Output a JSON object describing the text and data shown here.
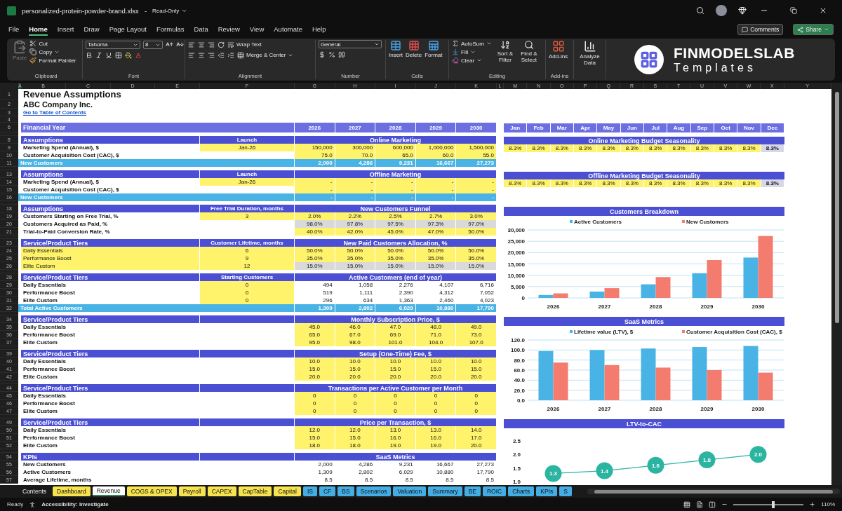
{
  "window": {
    "title": "personalized-protein-powder-brand.xlsx",
    "separator": "-",
    "mode": "Read-Only"
  },
  "menu": [
    {
      "label": "File",
      "selected": false
    },
    {
      "label": "Home",
      "selected": true
    },
    {
      "label": "Insert",
      "selected": false
    },
    {
      "label": "Draw",
      "selected": false
    },
    {
      "label": "Page Layout",
      "selected": false
    },
    {
      "label": "Formulas",
      "selected": false
    },
    {
      "label": "Data",
      "selected": false
    },
    {
      "label": "Review",
      "selected": false
    },
    {
      "label": "View",
      "selected": false
    },
    {
      "label": "Automate",
      "selected": false
    },
    {
      "label": "Help",
      "selected": false
    }
  ],
  "comments_button": "Comments",
  "share_button": "Share",
  "ribbon": {
    "clipboard": {
      "paste": "Paste",
      "paste_disabled": true,
      "cut": "Cut",
      "copy": "Copy",
      "format_painter": "Format Painter",
      "label": "Clipboard"
    },
    "font": {
      "name": "Tahoma",
      "size": "8",
      "label": "Font"
    },
    "alignment": {
      "wrap": "Wrap Text",
      "merge": "Merge & Center",
      "label": "Alignment"
    },
    "number": {
      "format": "General",
      "label": "Number"
    },
    "cells": {
      "insert": "Insert",
      "delete": "Delete",
      "format": "Format",
      "label": "Cells"
    },
    "editing": {
      "autosum": "AutoSum",
      "fill": "Fill",
      "clear": "Clear",
      "sort": "Sort & Filter",
      "find": "Find & Select",
      "label": "Editing"
    },
    "addins": {
      "button": "Add-ins",
      "label": "Add-ins"
    },
    "analyze": "Analyze Data",
    "logo": {
      "name": "FINMODELSLAB",
      "tagline": "Templates"
    }
  },
  "columns": [
    {
      "label": "A",
      "selected": true
    },
    {
      "label": "B",
      "selected": false
    },
    {
      "label": "C",
      "selected": false
    },
    {
      "label": "D",
      "selected": false
    },
    {
      "label": "E",
      "selected": false
    },
    {
      "label": "F",
      "selected": false
    },
    {
      "label": "G",
      "selected": false
    },
    {
      "label": "H",
      "selected": false
    },
    {
      "label": "I",
      "selected": false
    },
    {
      "label": "J",
      "selected": false
    },
    {
      "label": "K",
      "selected": false
    },
    {
      "label": "L",
      "selected": false
    },
    {
      "label": "M",
      "selected": false
    },
    {
      "label": "N",
      "selected": false
    },
    {
      "label": "O",
      "selected": false
    },
    {
      "label": "P",
      "selected": false
    },
    {
      "label": "Q",
      "selected": false
    },
    {
      "label": "R",
      "selected": false
    },
    {
      "label": "S",
      "selected": false
    },
    {
      "label": "T",
      "selected": false
    },
    {
      "label": "U",
      "selected": false
    },
    {
      "label": "V",
      "selected": false
    },
    {
      "label": "W",
      "selected": false
    },
    {
      "label": "X",
      "selected": false
    },
    {
      "label": "Y",
      "selected": false
    }
  ],
  "rows": [
    {
      "kind": "title",
      "row": "1",
      "text": "Revenue Assumptions"
    },
    {
      "kind": "subtitle",
      "row": "2",
      "text": "ABC Company Inc."
    },
    {
      "kind": "link",
      "row": "3",
      "text": "Go to Table of Contents"
    },
    {
      "kind": "blank",
      "row": "4"
    },
    {
      "kind": "year_header",
      "row": "6",
      "label": "Financial Year",
      "years": [
        "2026",
        "2027",
        "2028",
        "2029",
        "2030"
      ]
    },
    {
      "kind": "gap"
    },
    {
      "kind": "section",
      "row": "8",
      "label": "Assumptions",
      "mid": "Launch",
      "span": "Online Marketing"
    },
    {
      "kind": "input",
      "row": "9",
      "label": "Marketing Spend (Annual), $",
      "label_input": false,
      "mid": "Jan-26",
      "mid_input": true,
      "centered": false,
      "values": [
        "150,000",
        "300,000",
        "600,000",
        "1,000,000",
        "1,500,000"
      ]
    },
    {
      "kind": "input",
      "row": "10",
      "label": "Customer Acquisition Cost (CAC), $",
      "label_input": false,
      "mid_input": false,
      "centered": false,
      "values": [
        "75.0",
        "70.0",
        "65.0",
        "60.0",
        "55.0"
      ]
    },
    {
      "kind": "total",
      "row": "11",
      "label": "New Customers",
      "centered": false,
      "values": [
        "2,000",
        "4,286",
        "9,231",
        "16,667",
        "27,273"
      ]
    },
    {
      "kind": "gap"
    },
    {
      "kind": "section",
      "row": "13",
      "label": "Assumptions",
      "mid": "Launch",
      "span": "Offline Marketing"
    },
    {
      "kind": "input",
      "row": "14",
      "label": "Marketing Spend (Annual), $",
      "label_input": false,
      "mid": "Jan-26",
      "mid_input": true,
      "centered": false,
      "values": [
        "-",
        "-",
        "-",
        "-",
        "-"
      ]
    },
    {
      "kind": "input",
      "row": "15",
      "label": "Customer Acquisition Cost (CAC), $",
      "label_input": false,
      "mid_input": false,
      "centered": false,
      "values": [
        "-",
        "-",
        "-",
        "-",
        "-"
      ]
    },
    {
      "kind": "total",
      "row": "16",
      "label": "New Customers",
      "centered": false,
      "values": [
        "-",
        "-",
        "-",
        "-",
        "-"
      ]
    },
    {
      "kind": "gap"
    },
    {
      "kind": "section",
      "row": "18",
      "label": "Assumptions",
      "mid": "Free Trial Duration, months",
      "span": "New Customers Funnel"
    },
    {
      "kind": "input",
      "row": "19",
      "label": "Customers Starting on Free Trial, %",
      "label_input": false,
      "mid": "3",
      "mid_input": true,
      "centered": true,
      "values": [
        "2.0%",
        "2.2%",
        "2.5%",
        "2.7%",
        "3.0%"
      ]
    },
    {
      "kind": "gray",
      "row": "20",
      "label": "Customers Acquired as Paid, %",
      "label_input": false,
      "mid_input": false,
      "centered": true,
      "values": [
        "98.0%",
        "97.8%",
        "97.5%",
        "97.3%",
        "97.0%"
      ]
    },
    {
      "kind": "input",
      "row": "21",
      "label": "Trial-to-Paid Conversion Rate, %",
      "label_input": false,
      "mid_input": false,
      "centered": true,
      "values": [
        "40.0%",
        "42.0%",
        "45.0%",
        "47.0%",
        "50.0%"
      ]
    },
    {
      "kind": "gap"
    },
    {
      "kind": "section",
      "row": "23",
      "label": "Service/Product Tiers",
      "mid": "Customer Lifetime, months",
      "span": "New Paid Customers Allocation, %"
    },
    {
      "kind": "input",
      "row": "24",
      "label": "Daily Essentials",
      "label_input": true,
      "mid": "6",
      "mid_input": true,
      "centered": true,
      "values": [
        "50.0%",
        "50.0%",
        "50.0%",
        "50.0%",
        "50.0%"
      ]
    },
    {
      "kind": "input",
      "row": "25",
      "label": "Performance Boost",
      "label_input": true,
      "mid": "9",
      "mid_input": true,
      "centered": true,
      "values": [
        "35.0%",
        "35.0%",
        "35.0%",
        "35.0%",
        "35.0%"
      ]
    },
    {
      "kind": "gray",
      "row": "26",
      "label": "Elite Custom",
      "label_input": true,
      "mid": "12",
      "mid_input": true,
      "centered": true,
      "values": [
        "15.0%",
        "15.0%",
        "15.0%",
        "15.0%",
        "15.0%"
      ]
    },
    {
      "kind": "gap"
    },
    {
      "kind": "section",
      "row": "28",
      "label": "Service/Product Tiers",
      "mid": "Starting Customers",
      "span": "Active Customers (end of year)"
    },
    {
      "kind": "plain",
      "row": "29",
      "label": "Daily Essentials",
      "label_input": false,
      "mid": "0",
      "mid_input": true,
      "centered": false,
      "values": [
        "494",
        "1,058",
        "2,276",
        "4,107",
        "6,716"
      ]
    },
    {
      "kind": "plain",
      "row": "30",
      "label": "Performance Boost",
      "label_input": false,
      "mid": "0",
      "mid_input": true,
      "centered": false,
      "values": [
        "519",
        "1,111",
        "2,390",
        "4,312",
        "7,052"
      ]
    },
    {
      "kind": "plain",
      "row": "31",
      "label": "Elite Custom",
      "label_input": false,
      "mid": "0",
      "mid_input": true,
      "centered": false,
      "values": [
        "296",
        "634",
        "1,363",
        "2,460",
        "4,023"
      ]
    },
    {
      "kind": "total",
      "row": "32",
      "label": "Total Active Customers",
      "centered": false,
      "values": [
        "1,309",
        "2,802",
        "6,029",
        "10,880",
        "17,790"
      ]
    },
    {
      "kind": "gap"
    },
    {
      "kind": "section",
      "row": "34",
      "label": "Service/Product Tiers",
      "span": "Monthly Subscription Price, $"
    },
    {
      "kind": "input",
      "row": "35",
      "label": "Daily Essentials",
      "label_input": false,
      "mid_input": false,
      "centered": true,
      "values": [
        "45.0",
        "46.0",
        "47.0",
        "48.0",
        "49.0"
      ]
    },
    {
      "kind": "input",
      "row": "36",
      "label": "Performance Boost",
      "label_input": false,
      "mid_input": false,
      "centered": true,
      "values": [
        "65.0",
        "67.0",
        "69.0",
        "71.0",
        "73.0"
      ]
    },
    {
      "kind": "input",
      "row": "37",
      "label": "Elite Custom",
      "label_input": false,
      "mid_input": false,
      "centered": true,
      "values": [
        "95.0",
        "98.0",
        "101.0",
        "104.0",
        "107.0"
      ]
    },
    {
      "kind": "gap"
    },
    {
      "kind": "section",
      "row": "39",
      "label": "Service/Product Tiers",
      "span": "Setup (One-Time) Fee, $"
    },
    {
      "kind": "input",
      "row": "40",
      "label": "Daily Essentials",
      "label_input": false,
      "mid_input": false,
      "centered": true,
      "values": [
        "10.0",
        "10.0",
        "10.0",
        "10.0",
        "10.0"
      ]
    },
    {
      "kind": "input",
      "row": "41",
      "label": "Performance Boost",
      "label_input": false,
      "mid_input": false,
      "centered": true,
      "values": [
        "15.0",
        "15.0",
        "15.0",
        "15.0",
        "15.0"
      ]
    },
    {
      "kind": "input",
      "row": "42",
      "label": "Elite Custom",
      "label_input": false,
      "mid_input": false,
      "centered": true,
      "values": [
        "20.0",
        "20.0",
        "20.0",
        "20.0",
        "20.0"
      ]
    },
    {
      "kind": "gap"
    },
    {
      "kind": "section",
      "row": "44",
      "label": "Service/Product Tiers",
      "span": "Transactions per Active Customer per Month"
    },
    {
      "kind": "input",
      "row": "45",
      "label": "Daily Essentials",
      "label_input": false,
      "mid_input": false,
      "centered": true,
      "values": [
        "0",
        "0",
        "0",
        "0",
        "0"
      ]
    },
    {
      "kind": "input",
      "row": "46",
      "label": "Performance Boost",
      "label_input": false,
      "mid_input": false,
      "centered": true,
      "values": [
        "0",
        "0",
        "0",
        "0",
        "0"
      ]
    },
    {
      "kind": "input",
      "row": "47",
      "label": "Elite Custom",
      "label_input": false,
      "mid_input": false,
      "centered": true,
      "values": [
        "0",
        "0",
        "0",
        "0",
        "0"
      ]
    },
    {
      "kind": "gap"
    },
    {
      "kind": "section",
      "row": "49",
      "label": "Service/Product Tiers",
      "span": "Price per Transaction, $"
    },
    {
      "kind": "input",
      "row": "50",
      "label": "Daily Essentials",
      "label_input": false,
      "mid_input": false,
      "centered": true,
      "values": [
        "12.0",
        "12.0",
        "13.0",
        "13.0",
        "14.0"
      ]
    },
    {
      "kind": "input",
      "row": "51",
      "label": "Performance Boost",
      "label_input": false,
      "mid_input": false,
      "centered": true,
      "values": [
        "15.0",
        "15.0",
        "16.0",
        "16.0",
        "17.0"
      ]
    },
    {
      "kind": "input",
      "row": "52",
      "label": "Elite Custom",
      "label_input": false,
      "mid_input": false,
      "centered": true,
      "values": [
        "18.0",
        "18.0",
        "19.0",
        "19.0",
        "20.0"
      ]
    },
    {
      "kind": "gap"
    },
    {
      "kind": "section",
      "row": "54",
      "label": "KPIs",
      "span": "SaaS Metrics"
    },
    {
      "kind": "plain",
      "row": "55",
      "label": "New Customers",
      "label_input": false,
      "mid_input": false,
      "centered": false,
      "values": [
        "2,000",
        "4,286",
        "9,231",
        "16,667",
        "27,273"
      ]
    },
    {
      "kind": "plain",
      "row": "56",
      "label": "Active Customers",
      "label_input": false,
      "mid_input": false,
      "centered": false,
      "values": [
        "1,309",
        "2,802",
        "6,029",
        "10,880",
        "17,790"
      ]
    },
    {
      "kind": "plain",
      "row": "57",
      "label": "Average Lifetime, months",
      "label_input": false,
      "mid_input": false,
      "centered": false,
      "values": [
        "8.5",
        "8.5",
        "8.5",
        "8.5",
        "8.5"
      ]
    }
  ],
  "months": [
    "Jan",
    "Feb",
    "Mar",
    "Apr",
    "May",
    "Jun",
    "Jul",
    "Aug",
    "Sep",
    "Oct",
    "Nov",
    "Dec"
  ],
  "seasonality": [
    {
      "title": "Online Marketing Budget Seasonality",
      "cells": [
        {
          "text": "8.3%",
          "input": true
        },
        {
          "text": "8.3%",
          "input": true
        },
        {
          "text": "8.3%",
          "input": true
        },
        {
          "text": "8.3%",
          "input": true
        },
        {
          "text": "8.3%",
          "input": true
        },
        {
          "text": "8.3%",
          "input": true
        },
        {
          "text": "8.3%",
          "input": true
        },
        {
          "text": "8.3%",
          "input": true
        },
        {
          "text": "8.3%",
          "input": true
        },
        {
          "text": "8.3%",
          "input": true
        },
        {
          "text": "8.3%",
          "input": true
        },
        {
          "text": "8.3%",
          "input": false
        }
      ]
    },
    {
      "title": "Offline Marketing Budget Seasonality",
      "cells": [
        {
          "text": "8.3%",
          "input": true
        },
        {
          "text": "8.3%",
          "input": true
        },
        {
          "text": "8.3%",
          "input": true
        },
        {
          "text": "8.3%",
          "input": true
        },
        {
          "text": "8.3%",
          "input": true
        },
        {
          "text": "8.3%",
          "input": true
        },
        {
          "text": "8.3%",
          "input": true
        },
        {
          "text": "8.3%",
          "input": true
        },
        {
          "text": "8.3%",
          "input": true
        },
        {
          "text": "8.3%",
          "input": true
        },
        {
          "text": "8.3%",
          "input": true
        },
        {
          "text": "8.3%",
          "input": false
        }
      ]
    }
  ],
  "charts": [
    {
      "title": "Customers Breakdown",
      "chart_data": {
        "type": "bar",
        "categories": [
          "2026",
          "2027",
          "2028",
          "2029",
          "2030"
        ],
        "series": [
          {
            "name": "Active Customers",
            "color": "#4ab3e6",
            "values": [
              1300,
              2800,
              6000,
              10900,
              17800
            ]
          },
          {
            "name": "New Customers",
            "color": "#f47c6e",
            "values": [
              2000,
              4300,
              9200,
              16700,
              27300
            ]
          }
        ],
        "ylim": [
          0,
          30000
        ],
        "yticks": [
          {
            "value": 0,
            "label": "0"
          },
          {
            "value": 5000,
            "label": "5,000"
          },
          {
            "value": 10000,
            "label": "10,000"
          },
          {
            "value": 15000,
            "label": "15,000"
          },
          {
            "value": 20000,
            "label": "20,000"
          },
          {
            "value": 25000,
            "label": "25,000"
          },
          {
            "value": 30000,
            "label": "30,000"
          }
        ],
        "grid": true,
        "legend": "top"
      }
    },
    {
      "title": "SaaS Metrics",
      "chart_data": {
        "type": "bar",
        "categories": [
          "2026",
          "2027",
          "2028",
          "2029",
          "2030"
        ],
        "series": [
          {
            "name": "Lifetime value (LTV), $",
            "color": "#4ab3e6",
            "values": [
              98,
              100,
              103,
              106,
              108
            ]
          },
          {
            "name": "Customer Acquisition Cost (CAC), $",
            "color": "#f47c6e",
            "values": [
              75,
              70,
              65,
              60,
              55
            ]
          }
        ],
        "ylim": [
          0,
          120
        ],
        "yticks": [
          {
            "value": 0,
            "label": "0.0"
          },
          {
            "value": 20,
            "label": "20.0"
          },
          {
            "value": 40,
            "label": "40.0"
          },
          {
            "value": 60,
            "label": "60.0"
          },
          {
            "value": 80,
            "label": "80.0"
          },
          {
            "value": 100,
            "label": "100.0"
          },
          {
            "value": 120,
            "label": "120.0"
          }
        ],
        "grid": true,
        "legend": "top"
      }
    },
    {
      "title": "LTV-to-CAC",
      "chart_data": {
        "type": "line",
        "series": [
          {
            "color": "#2bb5a0",
            "values": [
              1.3,
              1.4,
              1.6,
              1.8,
              2.0
            ],
            "marker": "circle"
          }
        ],
        "ylim": [
          1,
          2.5
        ],
        "yticks": [
          {
            "value": 1,
            "label": "1.0"
          },
          {
            "value": 1.5,
            "label": "1.5"
          },
          {
            "value": 2,
            "label": "2.0"
          },
          {
            "value": 2.5,
            "label": "2.5"
          }
        ],
        "value_labels": [
          "1.3",
          "1.4",
          "1.6",
          "1.8",
          "2.0"
        ]
      }
    }
  ],
  "sheet_tabs": [
    {
      "label": "Contents",
      "selected": false
    },
    {
      "label": "Dashboard",
      "selected": false,
      "color": "#f7e34f"
    },
    {
      "label": "Revenue",
      "selected": true
    },
    {
      "label": "COGS & OPEX",
      "selected": false,
      "color": "#f7e34f"
    },
    {
      "label": "Payroll",
      "selected": false,
      "color": "#f7e34f"
    },
    {
      "label": "CAPEX",
      "selected": false,
      "color": "#f7e34f"
    },
    {
      "label": "CapTable",
      "selected": false,
      "color": "#f7e34f"
    },
    {
      "label": "Capital",
      "selected": false,
      "color": "#f7e34f"
    },
    {
      "label": "IS",
      "selected": false,
      "color": "#44ade3"
    },
    {
      "label": "CF",
      "selected": false,
      "color": "#44ade3"
    },
    {
      "label": "BS",
      "selected": false,
      "color": "#44ade3"
    },
    {
      "label": "Scenarios",
      "selected": false,
      "color": "#44ade3"
    },
    {
      "label": "Valuation",
      "selected": false,
      "color": "#44ade3"
    },
    {
      "label": "Summary",
      "selected": false,
      "color": "#44ade3"
    },
    {
      "label": "BE",
      "selected": false,
      "color": "#44ade3"
    },
    {
      "label": "ROIC",
      "selected": false,
      "color": "#44ade3"
    },
    {
      "label": "Charts",
      "selected": false,
      "color": "#44ade3"
    },
    {
      "label": "KPIs",
      "selected": false,
      "color": "#44ade3"
    },
    {
      "label": "S",
      "selected": false,
      "color": "#44ade3"
    }
  ],
  "status_bar": {
    "state": "Ready",
    "accessibility": "Accessibility: Investigate",
    "zoom": "110%",
    "level": 0.55
  }
}
